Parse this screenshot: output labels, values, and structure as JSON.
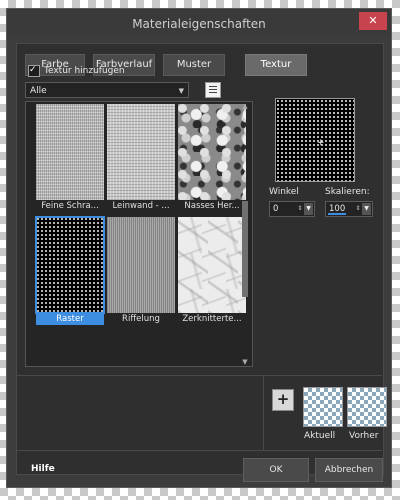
{
  "window": {
    "title": "Materialeigenschaften",
    "close_glyph": "✕"
  },
  "tabs": [
    {
      "label": "Farbe"
    },
    {
      "label": "Farbverlauf"
    },
    {
      "label": "Muster"
    },
    {
      "label": "Textur",
      "active": true
    }
  ],
  "texture": {
    "add_checkbox_label": "Textur hinzufügen",
    "add_checked": true,
    "category_value": "Alle",
    "library_icon": "library-icon",
    "tiles": [
      {
        "label": "Feine Schra..."
      },
      {
        "label": "Leinwand - ..."
      },
      {
        "label": "Nasses Her..."
      },
      {
        "label": "Raster",
        "selected": true
      },
      {
        "label": "Riffelung"
      },
      {
        "label": "Zerknitterte..."
      }
    ]
  },
  "settings": {
    "angle_label": "Winkel",
    "angle_value": "0",
    "scale_label": "Skalieren:",
    "scale_value": "100"
  },
  "swatches": {
    "current_label": "Aktuell",
    "previous_label": "Vorher"
  },
  "footer": {
    "help": "Hilfe",
    "ok": "OK",
    "cancel": "Abbrechen"
  }
}
